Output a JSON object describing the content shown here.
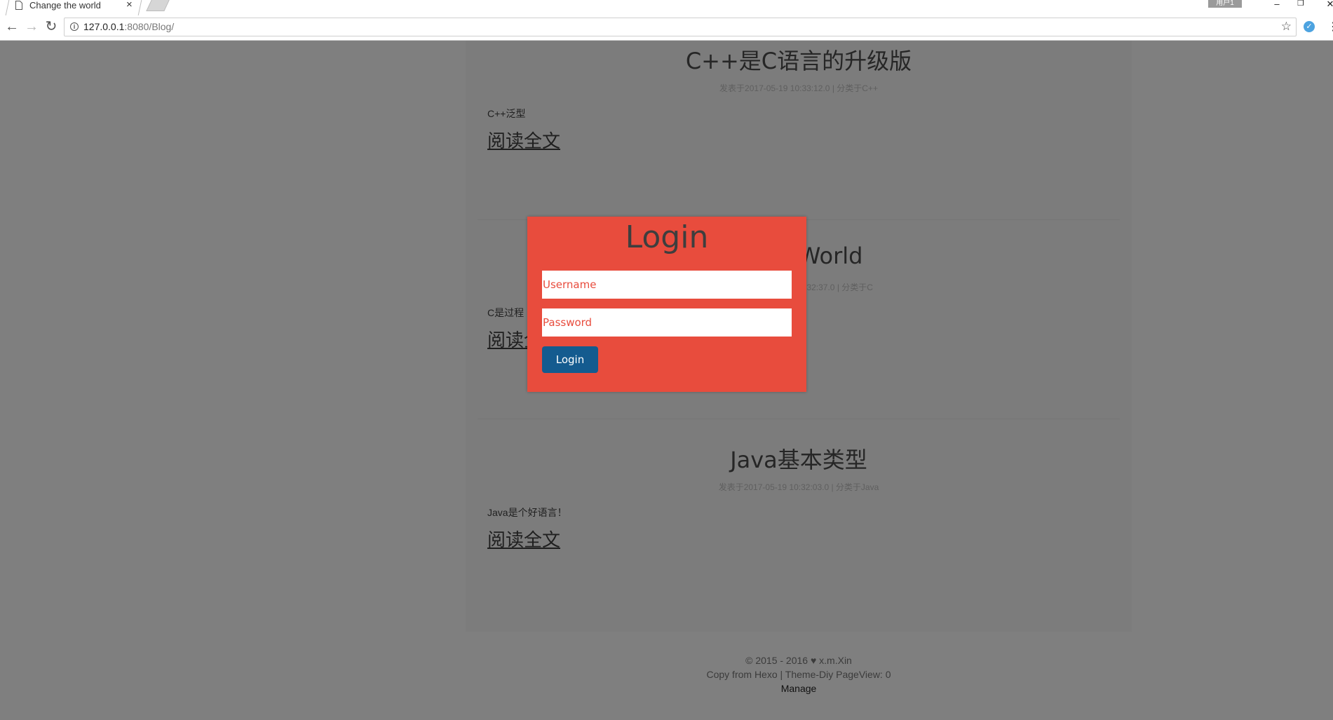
{
  "browser": {
    "tab_title": "Change the world",
    "close_glyph": "×",
    "user_badge": "用户1",
    "minimize_glyph": "–",
    "restore_glyph": "❐",
    "close_window_glyph": "✕",
    "back_glyph": "←",
    "forward_glyph": "→",
    "reload_glyph": "↻",
    "url_host": "127.0.0.1",
    "url_path": ":8080/Blog/",
    "star_glyph": "☆",
    "menu_glyph": "⋮"
  },
  "posts": [
    {
      "title": "C++是C语言的升级版",
      "meta": "发表于2017-05-19 10:33:12.0 | 分类于C++",
      "excerpt": "C++泛型",
      "read_more": "阅读全文"
    },
    {
      "title": "Hello World",
      "meta": "发表于2017-05-19 10:32:37.0 | 分类于C",
      "excerpt": "C是过程",
      "read_more": "阅读全文"
    },
    {
      "title": "Java基本类型",
      "meta": "发表于2017-05-19 10:32:03.0 | 分类于Java",
      "excerpt": "Java是个好语言！",
      "read_more": "阅读全文"
    }
  ],
  "footer": {
    "copyright": "© 2015 - 2016 ♥ x.m.Xin",
    "credits": "Copy from Hexo | Theme-Diy PageView: 0",
    "manage": "Manage"
  },
  "login_modal": {
    "title": "Login",
    "username_placeholder": "Username",
    "password_placeholder": "Password",
    "button_label": "Login",
    "accent_color": "#e84c3d",
    "button_color": "#145b8f"
  }
}
